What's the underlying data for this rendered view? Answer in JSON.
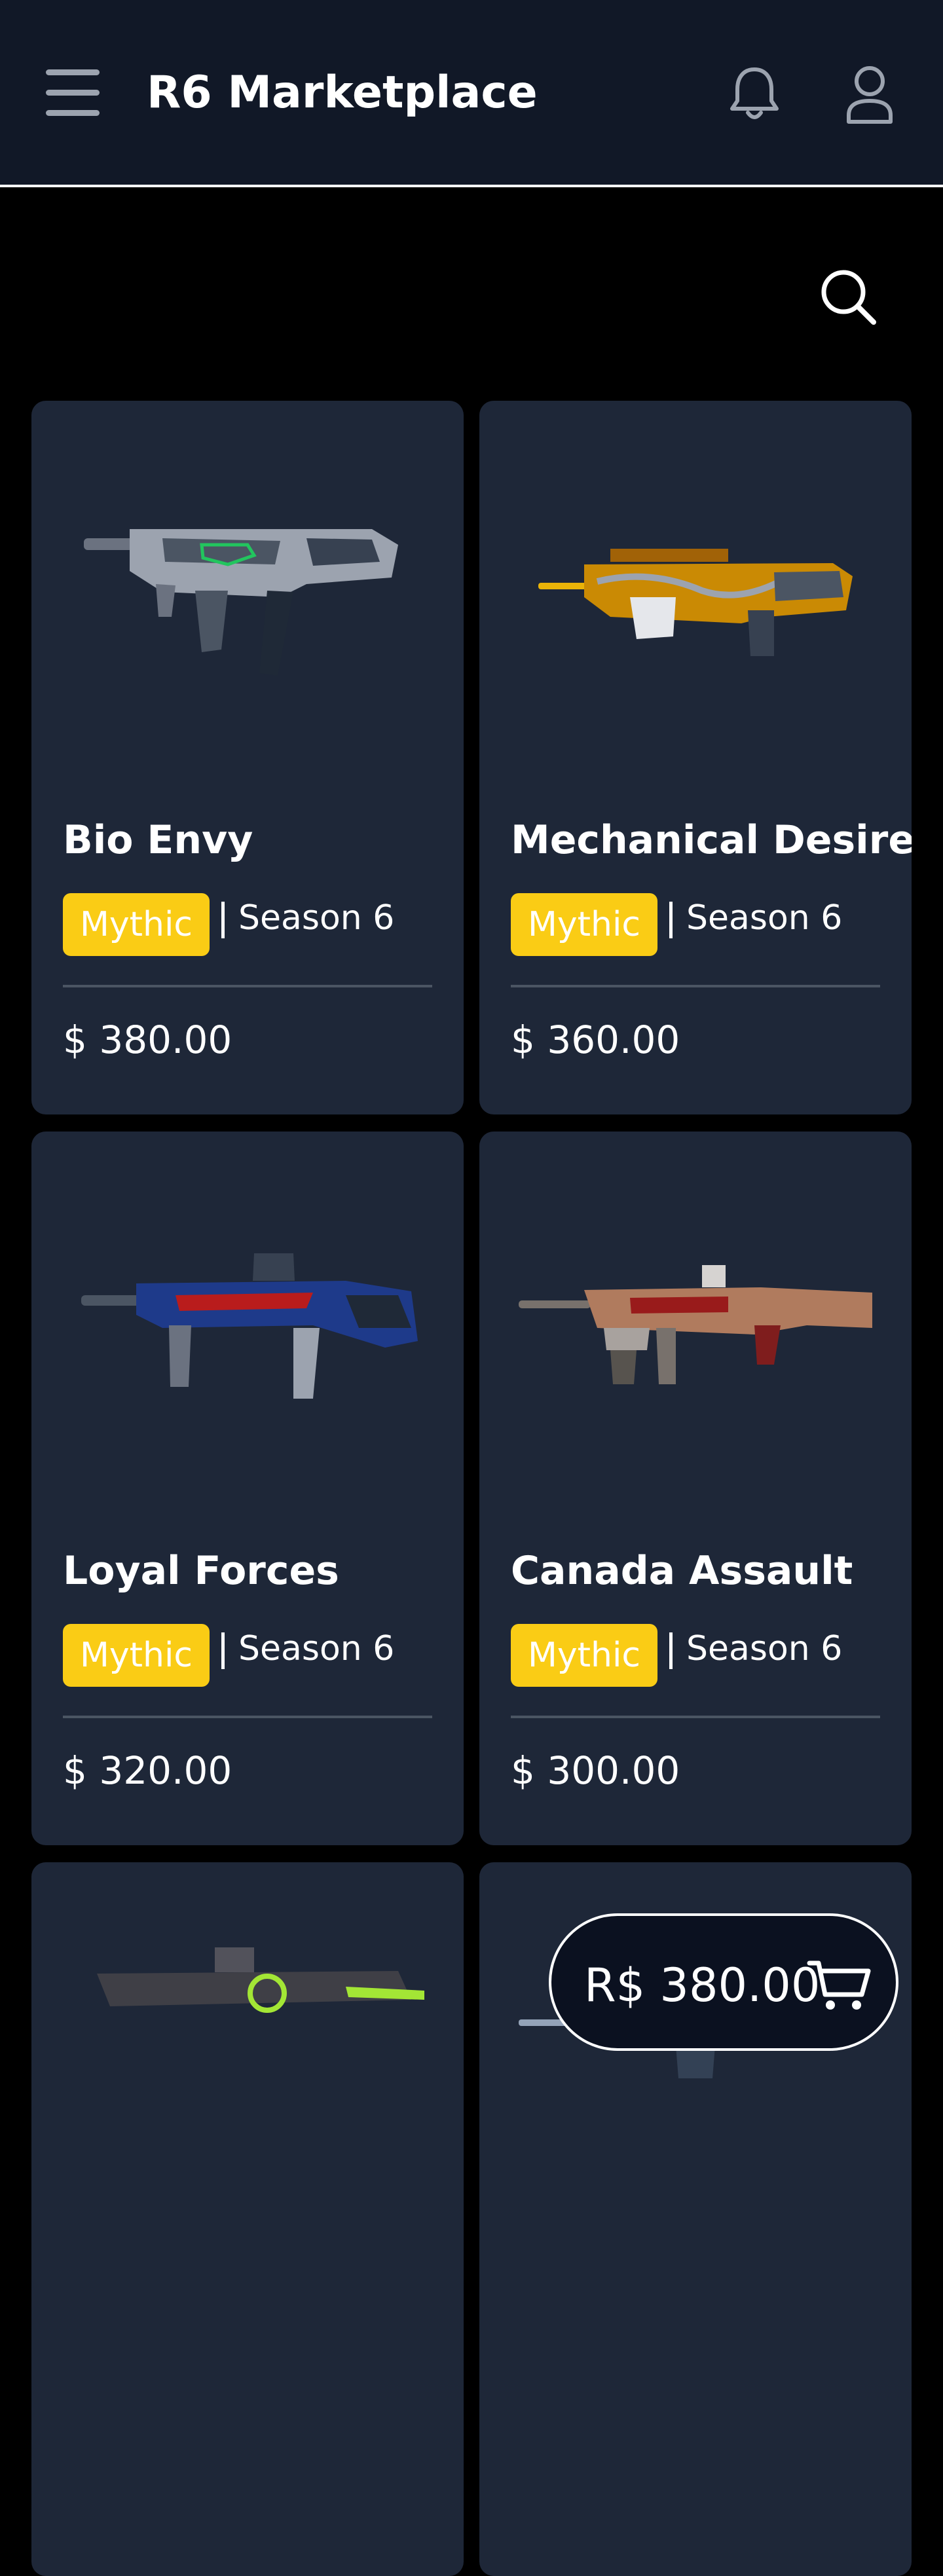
{
  "header": {
    "title": "R6 Marketplace",
    "menu_icon": "hamburger-menu-icon",
    "notification_icon": "bell-icon",
    "profile_icon": "user-icon"
  },
  "search": {
    "icon": "search-icon"
  },
  "colors": {
    "header_bg": "#111827",
    "page_bg": "#000000",
    "card_bg": "#1e2738",
    "rarity_badge": "#facc15",
    "divider": "#4b5563"
  },
  "items": [
    {
      "name": "Bio Envy",
      "rarity": "Mythic",
      "season": "Season 6",
      "price": "$ 380.00"
    },
    {
      "name": "Mechanical Desire",
      "rarity": "Mythic",
      "season": "Season 6",
      "price": "$ 360.00"
    },
    {
      "name": "Loyal Forces",
      "rarity": "Mythic",
      "season": "Season 6",
      "price": "$ 320.00"
    },
    {
      "name": "Canada Assault",
      "rarity": "Mythic",
      "season": "Season 6",
      "price": "$ 300.00"
    },
    {
      "name": "",
      "rarity": "",
      "season": "",
      "price": ""
    },
    {
      "name": "",
      "rarity": "",
      "season": "",
      "price": ""
    }
  ],
  "cart": {
    "total": "R$ 380.00",
    "icon": "shopping-cart-icon"
  }
}
